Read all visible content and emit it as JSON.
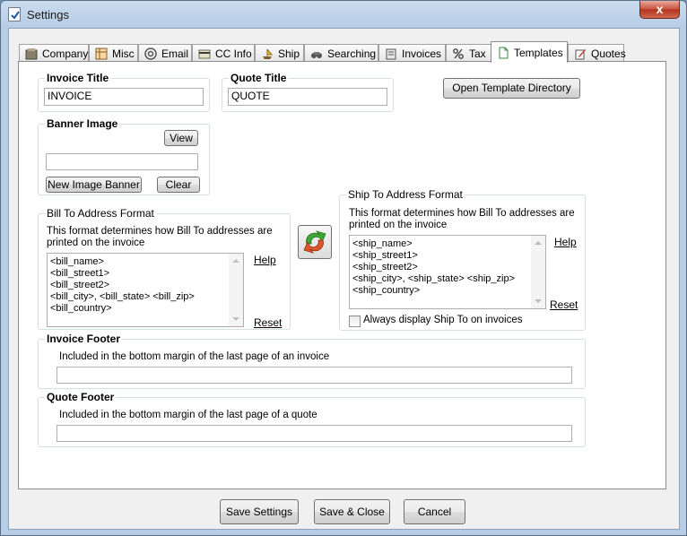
{
  "window": {
    "title": "Settings",
    "close_glyph": "x"
  },
  "tabs": [
    {
      "label": "Company",
      "icon": "company-icon"
    },
    {
      "label": "Misc",
      "icon": "misc-icon"
    },
    {
      "label": "Email",
      "icon": "email-icon"
    },
    {
      "label": "CC Info",
      "icon": "credit-card-icon"
    },
    {
      "label": "Ship",
      "icon": "ship-icon"
    },
    {
      "label": "Searching",
      "icon": "binoculars-icon"
    },
    {
      "label": "Invoices",
      "icon": "invoices-icon"
    },
    {
      "label": "Tax",
      "icon": "percent-icon"
    },
    {
      "label": "Templates",
      "icon": "document-icon",
      "active": true
    },
    {
      "label": "Quotes",
      "icon": "quotes-icon"
    }
  ],
  "invoice_title": {
    "label": "Invoice Title",
    "value": "INVOICE"
  },
  "quote_title": {
    "label": "Quote Title",
    "value": "QUOTE"
  },
  "open_template_directory": "Open Template Directory",
  "banner": {
    "label": "Banner Image",
    "view": "View",
    "path_value": "",
    "new_banner": "New Image Banner",
    "clear": "Clear"
  },
  "bill_to": {
    "label": "Bill To Address Format",
    "description": "This format determines how Bill To addresses are printed on the invoice",
    "lines": [
      "<bill_name>",
      "<bill_street1>",
      "<bill_street2>",
      "<bill_city>, <bill_state> <bill_zip>",
      "<bill_country>"
    ],
    "help": "Help",
    "reset": "Reset"
  },
  "ship_to": {
    "label": "Ship To Address Format",
    "description": "This format determines how Bill To addresses are printed on the invoice",
    "lines": [
      "<ship_name>",
      "<ship_street1>",
      "<ship_street2>",
      "<ship_city>, <ship_state> <ship_zip>",
      "<ship_country>"
    ],
    "help": "Help",
    "reset": "Reset",
    "always_display": {
      "label": "Always display Ship To on invoices",
      "checked": false
    }
  },
  "invoice_footer": {
    "label": "Invoice Footer",
    "description": "Included in the bottom margin of the last page of an invoice",
    "value": ""
  },
  "quote_footer": {
    "label": "Quote Footer",
    "description": "Included in the bottom margin of the last page of a quote",
    "value": ""
  },
  "buttons": {
    "save_settings": "Save Settings",
    "save_close": "Save & Close",
    "cancel": "Cancel"
  },
  "colors": {
    "title_gradient": "#b7cde6",
    "close_red": "#c7503d",
    "panel_bg": "#ffffff",
    "client_bg": "#f0f0f0"
  }
}
